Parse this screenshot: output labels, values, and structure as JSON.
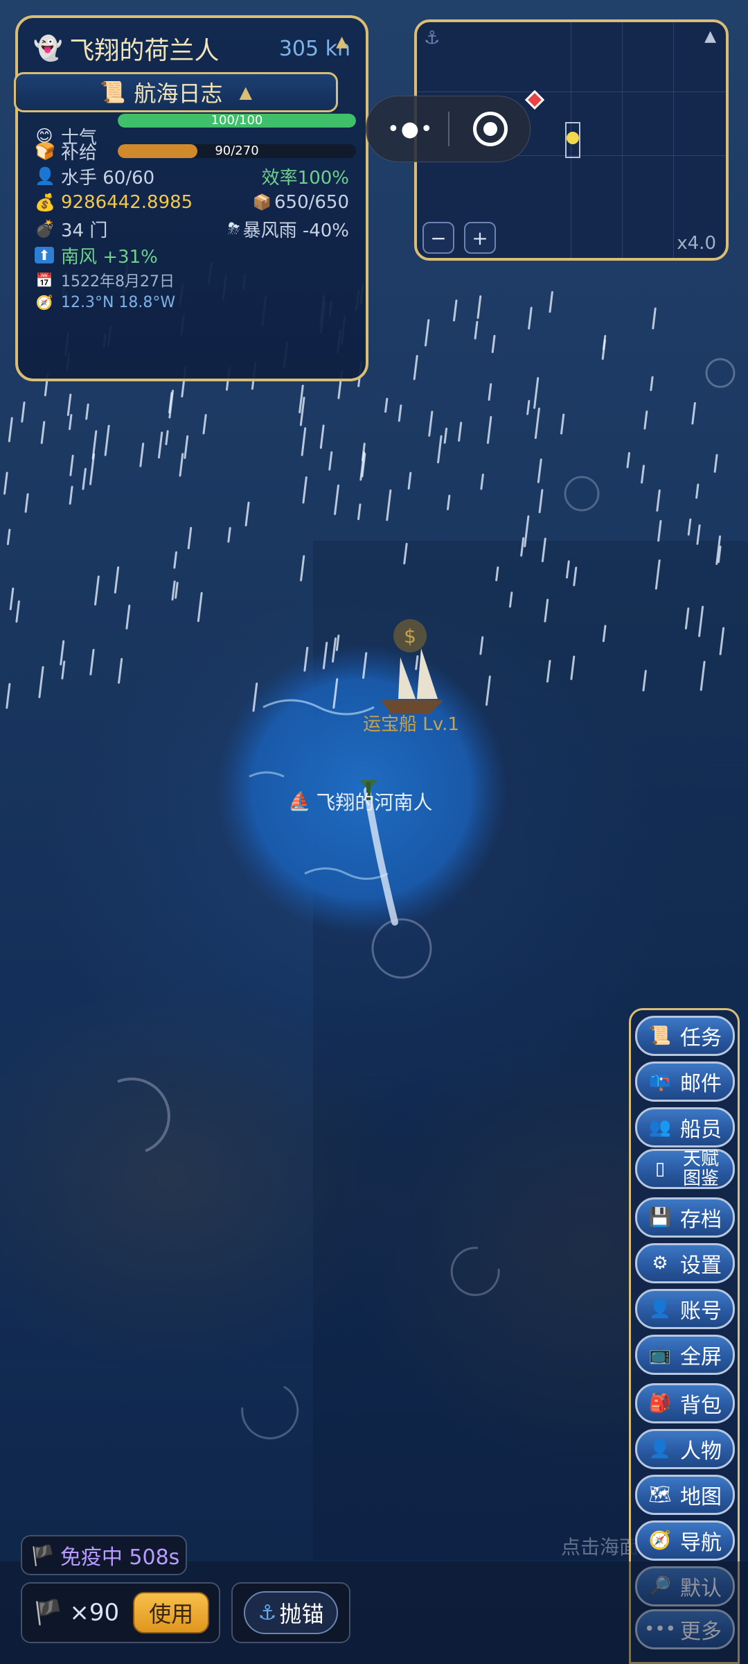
{
  "ship_panel": {
    "ship_name": "飞翔的荷兰人",
    "speed": "305 kn",
    "logbook_label": "航海日志",
    "morale_label": "士气",
    "morale_value": "100/100",
    "morale_progress": 1.0,
    "supply_label": "补给",
    "supply_value": "90/270",
    "supply_progress": 0.333,
    "crew": "水手 60/60",
    "efficiency": "效率100%",
    "gold": "9286442.8985",
    "cargo": "650/650",
    "cannons": "34 门",
    "weather": "暴风雨 -40%",
    "wind": "南风 +31%",
    "date": "1522年8月27日",
    "coordinates": "12.3°N  18.8°W"
  },
  "minimap": {
    "zoom": "x4.0",
    "zoom_out_label": "−",
    "zoom_in_label": "+"
  },
  "map": {
    "treasure_ship_label": "运宝船 Lv.1",
    "player_ship_label": "飞翔的河南人",
    "hint_text": "点击海面"
  },
  "side_menu": {
    "items": [
      {
        "label": "任务",
        "icon": "scroll-icon"
      },
      {
        "label": "邮件",
        "icon": "mailbox-icon"
      },
      {
        "label": "船员",
        "icon": "crew-icon"
      },
      {
        "label": "天赋图鉴",
        "icon": "talent-icon"
      },
      {
        "label": "存档",
        "icon": "save-icon"
      },
      {
        "label": "设置",
        "icon": "gear-icon"
      },
      {
        "label": "账号",
        "icon": "account-icon"
      },
      {
        "label": "全屏",
        "icon": "tv-icon"
      },
      {
        "label": "背包",
        "icon": "backpack-icon"
      },
      {
        "label": "人物",
        "icon": "person-icon"
      },
      {
        "label": "地图",
        "icon": "map-icon"
      },
      {
        "label": "导航",
        "icon": "compass-icon"
      },
      {
        "label": "默认",
        "icon": "magnifier-icon"
      },
      {
        "label": "更多",
        "icon": "more-icon"
      }
    ]
  },
  "bottom": {
    "immunity": "免疫中 508s",
    "flag_count": "×90",
    "use_label": "使用",
    "anchor_label": "抛锚"
  },
  "colors": {
    "gold_border": "#d9be73",
    "morale_bar": "#3fbf6a",
    "supply_bar": "#d08a2c",
    "efficiency_green": "#6fd08c",
    "gold_text": "#f2c94c",
    "wind_green": "#6fd08c",
    "immunity_purple": "#b89cff",
    "use_button": "#f0a830"
  }
}
